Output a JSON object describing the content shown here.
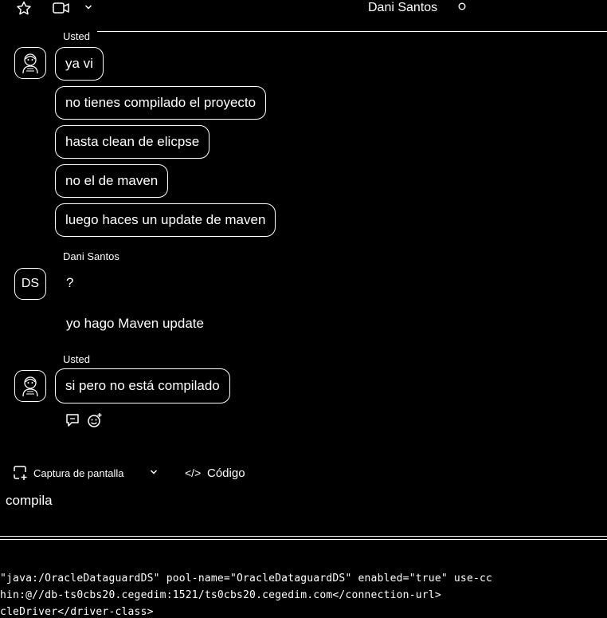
{
  "header": {
    "contact_name": "Dani Santos"
  },
  "messages": {
    "group1": {
      "sender": "Usted",
      "bubbles": [
        "ya vi",
        "no tienes compilado el proyecto",
        "hasta clean de elicpse",
        "no el de maven",
        "luego haces un update de maven"
      ]
    },
    "group2": {
      "sender": "Dani Santos",
      "initials": "DS",
      "lines": [
        "?",
        "yo hago Maven update"
      ]
    },
    "group3": {
      "sender": "Usted",
      "bubble": "si pero no está compilado"
    }
  },
  "compose": {
    "screenshot_label": "Captura de pantalla",
    "code_label": "Código",
    "code_glyph": "</>",
    "input_text": "compila"
  },
  "code_panel": {
    "lines": [
      "\"java:/OracleDataguardDS\" pool-name=\"OracleDataguardDS\" enabled=\"true\" use-cc",
      "hin:@//db-ts0cbs20.cegedim:1521/ts0cbs20.cegedim.com</connection-url>",
      "cleDriver</driver-class>"
    ]
  },
  "colors": {
    "background": "#000000",
    "foreground": "#ffffff"
  }
}
